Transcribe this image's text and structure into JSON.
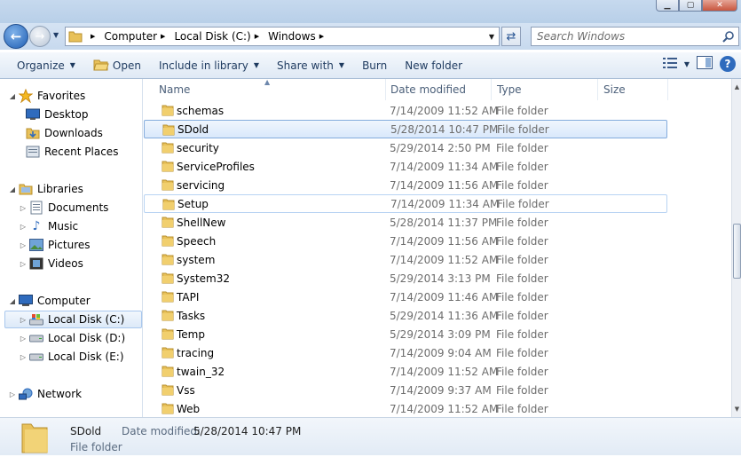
{
  "address": {
    "crumbs": [
      "Computer",
      "Local Disk (C:)",
      "Windows"
    ]
  },
  "search": {
    "placeholder": "Search Windows"
  },
  "toolbar": {
    "organize": "Organize",
    "open": "Open",
    "include_in_library": "Include in library",
    "share_with": "Share with",
    "burn": "Burn",
    "new_folder": "New folder"
  },
  "sidebar": {
    "favorites": "Favorites",
    "desktop": "Desktop",
    "downloads": "Downloads",
    "recent_places": "Recent Places",
    "libraries": "Libraries",
    "documents": "Documents",
    "music": "Music",
    "pictures": "Pictures",
    "videos": "Videos",
    "computer": "Computer",
    "local_c": "Local Disk (C:)",
    "local_d": "Local Disk (D:)",
    "local_e": "Local Disk (E:)",
    "network": "Network"
  },
  "columns": {
    "name": "Name",
    "date_modified": "Date modified",
    "type": "Type",
    "size": "Size"
  },
  "files": [
    {
      "name": "schemas",
      "date": "7/14/2009 11:52 AM",
      "type": "File folder"
    },
    {
      "name": "SDold",
      "date": "5/28/2014 10:47 PM",
      "type": "File folder"
    },
    {
      "name": "security",
      "date": "5/29/2014 2:50 PM",
      "type": "File folder"
    },
    {
      "name": "ServiceProfiles",
      "date": "7/14/2009 11:34 AM",
      "type": "File folder"
    },
    {
      "name": "servicing",
      "date": "7/14/2009 11:56 AM",
      "type": "File folder"
    },
    {
      "name": "Setup",
      "date": "7/14/2009 11:34 AM",
      "type": "File folder"
    },
    {
      "name": "ShellNew",
      "date": "5/28/2014 11:37 PM",
      "type": "File folder"
    },
    {
      "name": "Speech",
      "date": "7/14/2009 11:56 AM",
      "type": "File folder"
    },
    {
      "name": "system",
      "date": "7/14/2009 11:52 AM",
      "type": "File folder"
    },
    {
      "name": "System32",
      "date": "5/29/2014 3:13 PM",
      "type": "File folder"
    },
    {
      "name": "TAPI",
      "date": "7/14/2009 11:46 AM",
      "type": "File folder"
    },
    {
      "name": "Tasks",
      "date": "5/29/2014 11:36 AM",
      "type": "File folder"
    },
    {
      "name": "Temp",
      "date": "5/29/2014 3:09 PM",
      "type": "File folder"
    },
    {
      "name": "tracing",
      "date": "7/14/2009 9:04 AM",
      "type": "File folder"
    },
    {
      "name": "twain_32",
      "date": "7/14/2009 11:52 AM",
      "type": "File folder"
    },
    {
      "name": "Vss",
      "date": "7/14/2009 9:37 AM",
      "type": "File folder"
    },
    {
      "name": "Web",
      "date": "7/14/2009 11:52 AM",
      "type": "File folder"
    }
  ],
  "details": {
    "name": "SDold",
    "modified_label": "Date modified:",
    "modified_value": "5/28/2014 10:47 PM",
    "type": "File folder"
  },
  "colors": {
    "selection_border": "#84acdd",
    "accent": "#2f6bbd"
  }
}
